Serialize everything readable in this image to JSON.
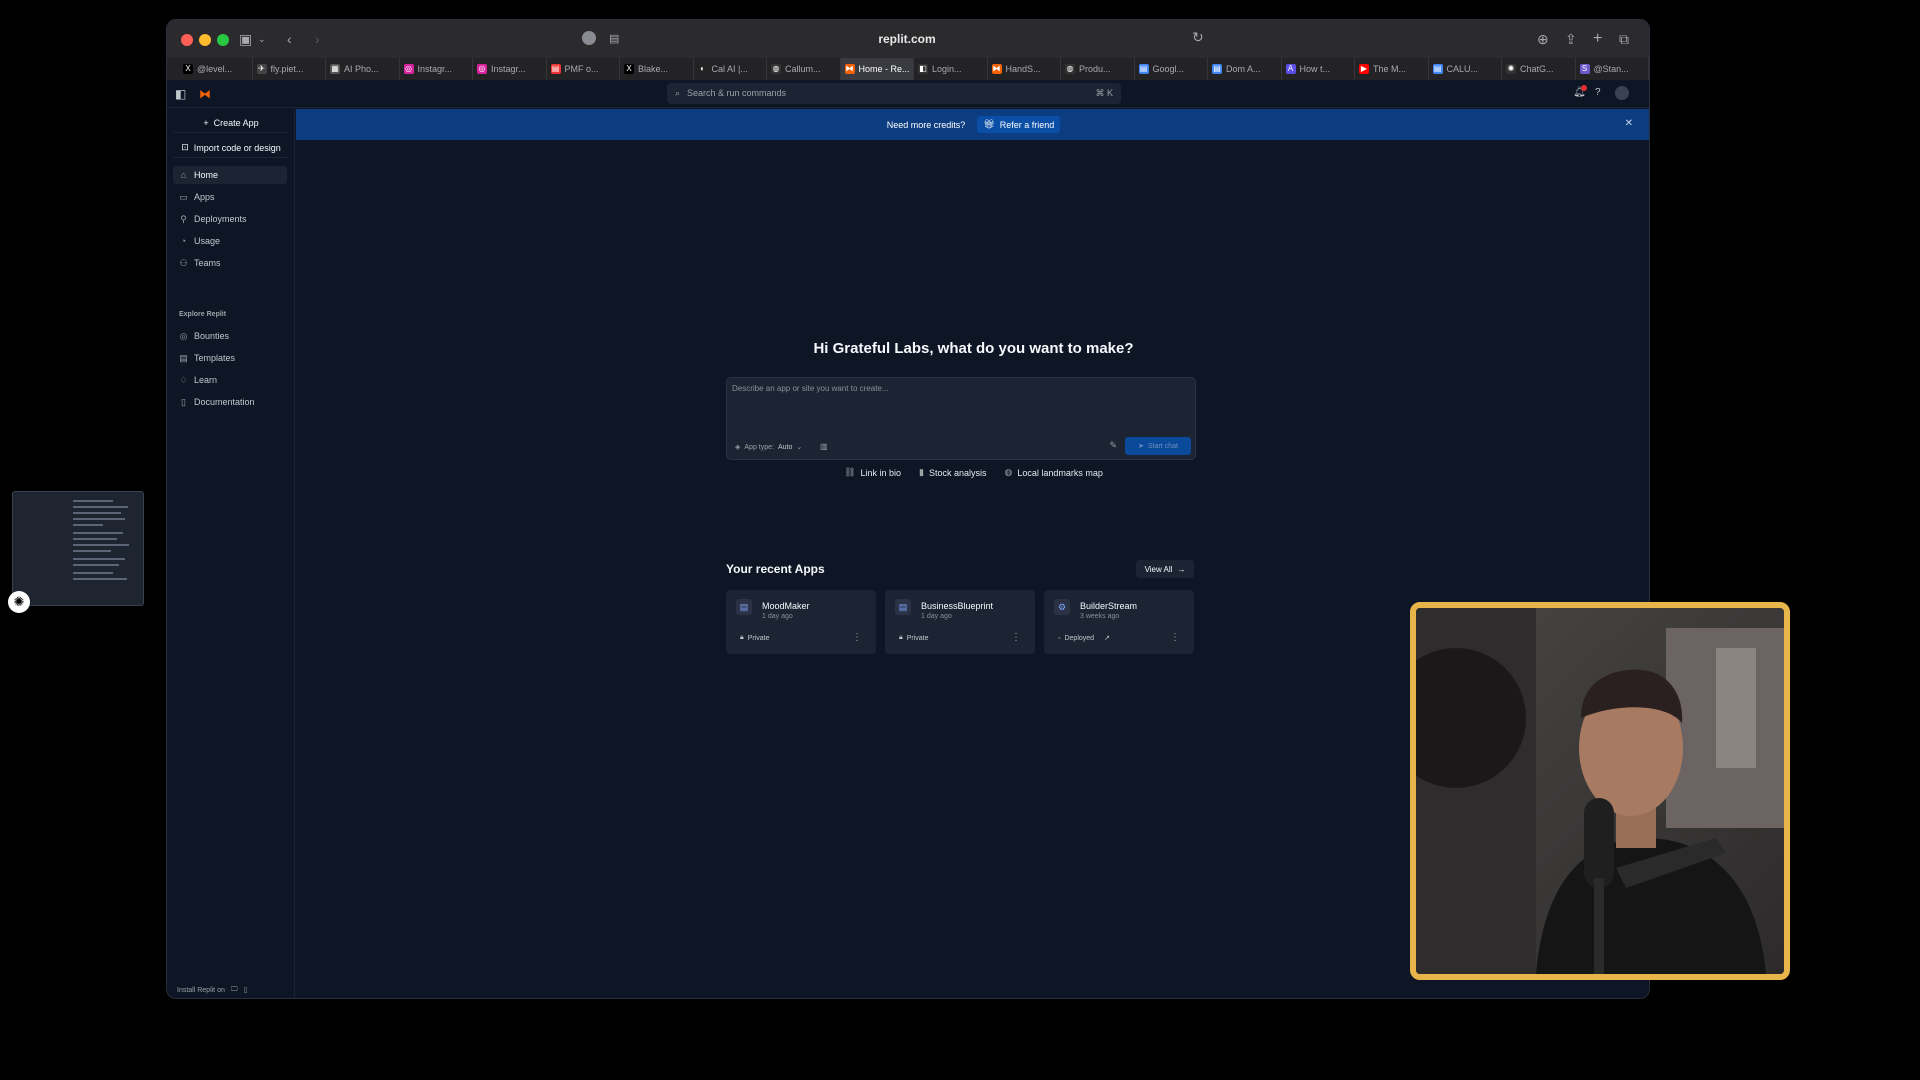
{
  "browser": {
    "url": "replit.com",
    "tabs": [
      {
        "label": "@level...",
        "icon": "x-icon"
      },
      {
        "label": "fly.piet...",
        "icon": "plane-icon"
      },
      {
        "label": "AI Pho...",
        "icon": "grid-icon"
      },
      {
        "label": "Instagr...",
        "icon": "instagram-icon"
      },
      {
        "label": "Instagr...",
        "icon": "instagram-icon"
      },
      {
        "label": "PMF o...",
        "icon": "doc-icon"
      },
      {
        "label": "Blake...",
        "icon": "x-icon"
      },
      {
        "label": "Cal AI |...",
        "icon": "cal-icon"
      },
      {
        "label": "Callum...",
        "icon": "globe-icon"
      },
      {
        "label": "Home - Re...",
        "icon": "replit-icon"
      },
      {
        "label": "Login...",
        "icon": "login-icon"
      },
      {
        "label": "HandS...",
        "icon": "replit-icon"
      },
      {
        "label": "Produ...",
        "icon": "globe-icon"
      },
      {
        "label": "Googl...",
        "icon": "google-doc-icon"
      },
      {
        "label": "Dom A...",
        "icon": "google-doc-icon"
      },
      {
        "label": "How t...",
        "icon": "a-icon"
      },
      {
        "label": "The M...",
        "icon": "youtube-icon"
      },
      {
        "label": "CALU...",
        "icon": "google-doc-icon"
      },
      {
        "label": "ChatG...",
        "icon": "chatgpt-icon"
      },
      {
        "label": "@Stan...",
        "icon": "s-icon"
      }
    ],
    "active_tab": 9
  },
  "topbar": {
    "search_placeholder": "Search & run commands",
    "shortcut": "⌘ K"
  },
  "sidebar": {
    "create_app": "Create App",
    "import": "Import code or design",
    "nav": [
      {
        "label": "Home",
        "icon": "home-icon"
      },
      {
        "label": "Apps",
        "icon": "folder-icon"
      },
      {
        "label": "Deployments",
        "icon": "rocket-icon"
      },
      {
        "label": "Usage",
        "icon": "gauge-icon"
      },
      {
        "label": "Teams",
        "icon": "people-icon"
      }
    ],
    "explore_heading": "Explore Replit",
    "explore": [
      {
        "label": "Bounties",
        "icon": "coin-icon"
      },
      {
        "label": "Templates",
        "icon": "template-icon"
      },
      {
        "label": "Learn",
        "icon": "bulb-icon"
      },
      {
        "label": "Documentation",
        "icon": "book-icon"
      }
    ],
    "install_label": "Install Replit on"
  },
  "banner": {
    "text": "Need more credits?",
    "refer": "Refer a friend"
  },
  "main": {
    "greeting": "Hi Grateful Labs, what do you want to make?",
    "prompt_placeholder": "Describe an app or site you want to create...",
    "app_type_label": "App type:",
    "app_type_value": "Auto",
    "start_button": "Start chat",
    "suggestions": [
      {
        "label": "Link in bio",
        "icon": "link-icon"
      },
      {
        "label": "Stock analysis",
        "icon": "bar-chart-icon"
      },
      {
        "label": "Local landmarks map",
        "icon": "globe-icon"
      }
    ],
    "recent_title": "Your recent Apps",
    "view_all": "View All",
    "recent_apps": [
      {
        "name": "MoodMaker",
        "ago": "1 day ago",
        "visibility": "Private"
      },
      {
        "name": "BusinessBlueprint",
        "ago": "1 day ago",
        "visibility": "Private"
      },
      {
        "name": "BuilderStream",
        "ago": "3 weeks ago",
        "visibility": "Deployed"
      }
    ]
  },
  "colors": {
    "background": "#0e1525",
    "surface": "#1c2333",
    "banner": "#0c3d80",
    "accent": "#0b4a9a",
    "webcam_border": "#e8b54a"
  }
}
